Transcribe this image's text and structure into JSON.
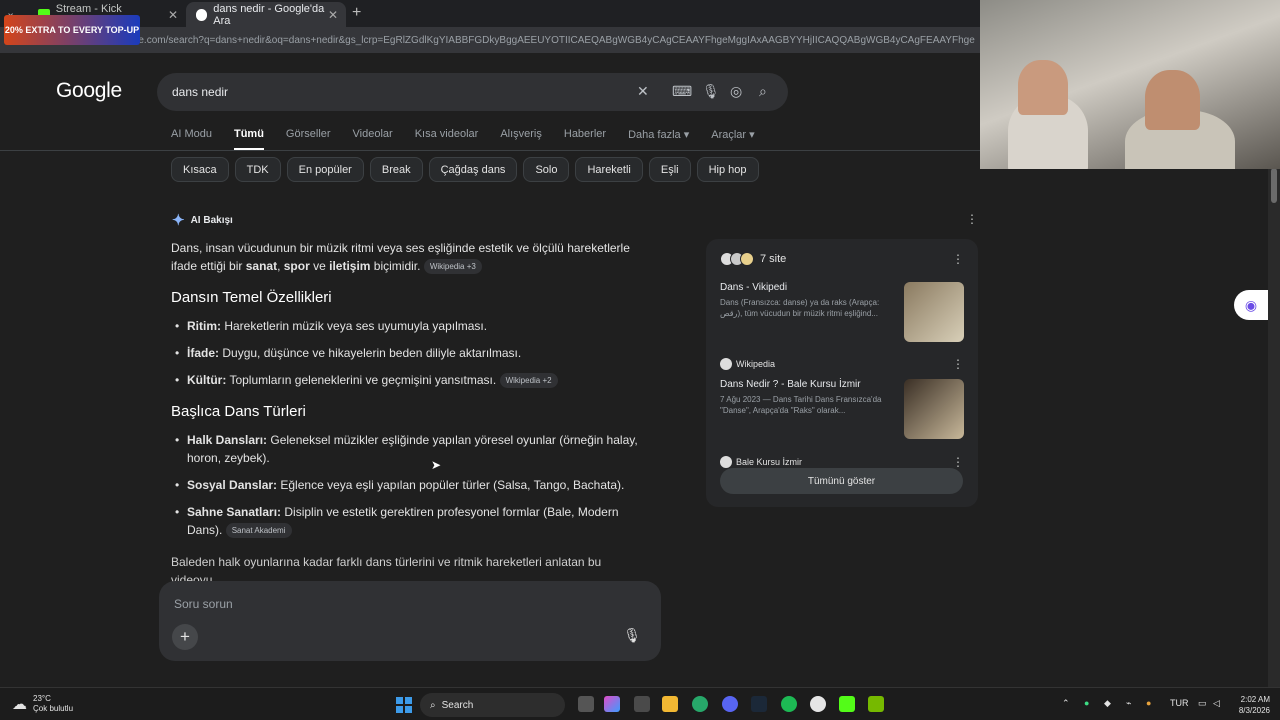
{
  "browser": {
    "tabs": [
      {
        "title": "Stream - Kick Dashboard"
      },
      {
        "title": "dans nedir - Google'da Ara"
      }
    ],
    "promo_text": "20% EXTRA TO EVERY TOP-UP",
    "url": "https://www.google.com/search?q=dans+nedir&oq=dans+nedir&gs_lcrp=EgRlZGdlKgYIABBFGDkyBggAEEUYOTIICAEQABgWGB4yCAgCEAAYFhgeMggIAxAAGBYYHjIICAQQABgWGB4yCAgFEAAYFhgeMggIBhAAGBYYHjIICA"
  },
  "google": {
    "logo": "Google",
    "query": "dans nedir",
    "nav_tabs": [
      "AI Modu",
      "Tümü",
      "Görseller",
      "Videolar",
      "Kısa videolar",
      "Alışveriş",
      "Haberler",
      "Daha fazla ▾",
      "Araçlar ▾"
    ],
    "chips": [
      "Kısaca",
      "TDK",
      "En popüler",
      "Break",
      "Çağdaş dans",
      "Solo",
      "Hareketli",
      "Eşli",
      "Hip hop"
    ]
  },
  "ai_overview": {
    "header": "AI Bakışı",
    "intro_a": "Dans, insan vücudunun bir müzik ritmi veya ses eşliğinde estetik ve ölçülü hareketlerle ifade ettiği bir ",
    "intro_b1": "sanat",
    "intro_b2": "spor",
    "intro_and": " ve ",
    "intro_b3": "iletişim",
    "intro_end": " biçimidir.",
    "intro_cite": "Wikipedia +3",
    "section1_title": "Dansın Temel Özellikleri",
    "section1_items": [
      {
        "term": "Ritim:",
        "text": " Hareketlerin müzik veya ses uyumuyla yapılması."
      },
      {
        "term": "İfade:",
        "text": " Duygu, düşünce ve hikayelerin beden diliyle aktarılması."
      },
      {
        "term": "Kültür:",
        "text": " Toplumların geleneklerini ve geçmişini yansıtması.",
        "cite": "Wikipedia +2"
      }
    ],
    "section2_title": "Başlıca Dans Türleri",
    "section2_items": [
      {
        "term": "Halk Dansları:",
        "text": " Geleneksel müzikler eşliğinde yapılan yöresel oyunlar (örneğin halay, horon, zeybek)."
      },
      {
        "term": "Sosyal Danslar:",
        "text": " Eğlence veya eşli yapılan popüler türler (Salsa, Tango, Bachata)."
      },
      {
        "term": "Sahne Sanatları:",
        "text": " Disiplin ve estetik gerektiren profesyonel formlar (Bale, Modern Dans).",
        "cite": "Sanat Akademi"
      }
    ],
    "outro": "Baleden halk oyunlarına kadar farklı dans türlerini ve ritmik hareketleri anlatan bu videoyu",
    "ask_placeholder": "Soru sorun"
  },
  "sources": {
    "count_label": "7 site",
    "cards": [
      {
        "title": "Dans - Vikipedi",
        "snippet": "Dans (Fransızca: danse) ya da raks (Arapça: رقص), tüm vücudun bir müzik ritmi eşliğind...",
        "site": "Wikipedia"
      },
      {
        "title": "Dans Nedir ? - Bale Kursu İzmir",
        "snippet": "7 Ağu 2023 — Dans Tarihi Dans Fransızca'da \"Danse\", Arapça'da \"Raks\" olarak...",
        "site": "Bale Kursu İzmir"
      }
    ],
    "show_all": "Tümünü göster"
  },
  "taskbar": {
    "temp": "23°C",
    "weather": "Çok bulutlu",
    "search": "Search",
    "lang": "TUR",
    "time": "2:02 AM",
    "date": "8/3/2026"
  },
  "icons": {
    "accent": "#8ab4f8",
    "start_color": "#3d9be9"
  }
}
